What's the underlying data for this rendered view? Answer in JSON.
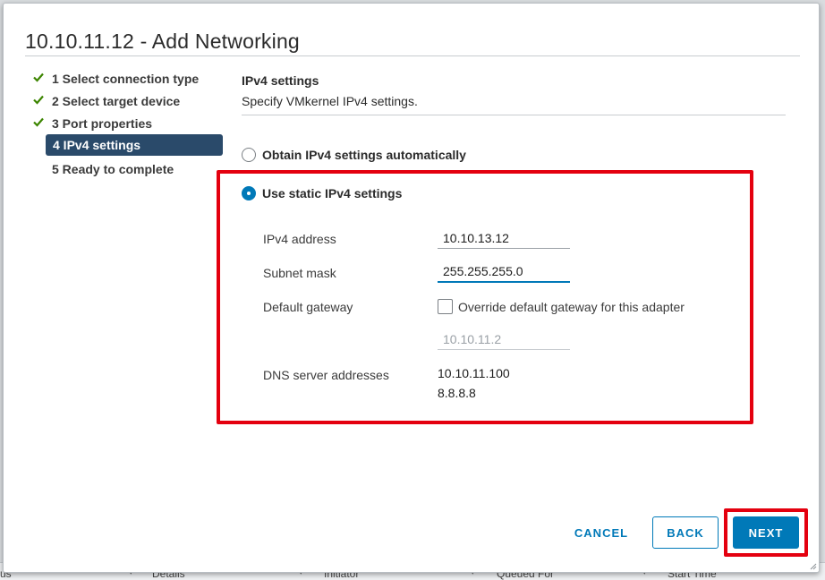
{
  "dialog": {
    "title": "10.10.11.12 - Add Networking"
  },
  "steps": [
    {
      "label": "1 Select connection type",
      "status": "done"
    },
    {
      "label": "2 Select target device",
      "status": "done"
    },
    {
      "label": "3 Port properties",
      "status": "done"
    },
    {
      "label": "4 IPv4 settings",
      "status": "active"
    },
    {
      "label": "5 Ready to complete",
      "status": "pending"
    }
  ],
  "section": {
    "title": "IPv4 settings",
    "description": "Specify VMkernel IPv4 settings."
  },
  "options": {
    "auto_label": "Obtain IPv4 settings automatically",
    "static_label": "Use static IPv4 settings",
    "selected": "static"
  },
  "form": {
    "ipv4_label": "IPv4 address",
    "ipv4_value": "10.10.13.12",
    "subnet_label": "Subnet mask",
    "subnet_value": "255.255.255.0",
    "gateway_label": "Default gateway",
    "override_label": "Override default gateway for this adapter",
    "override_checked": false,
    "gateway_value": "10.10.11.2",
    "dns_label": "DNS server addresses",
    "dns_values": [
      "10.10.11.100",
      "8.8.8.8"
    ]
  },
  "buttons": {
    "cancel": "CANCEL",
    "back": "BACK",
    "next": "NEXT"
  },
  "background_table": {
    "columns": [
      "us",
      "Details",
      "Initiator",
      "Queued For",
      "Start Time"
    ]
  },
  "colors": {
    "accent": "#0079b8",
    "active_step_bg": "#2a4a6a",
    "check_green": "#3c8500",
    "highlight_red": "#e4000f"
  }
}
